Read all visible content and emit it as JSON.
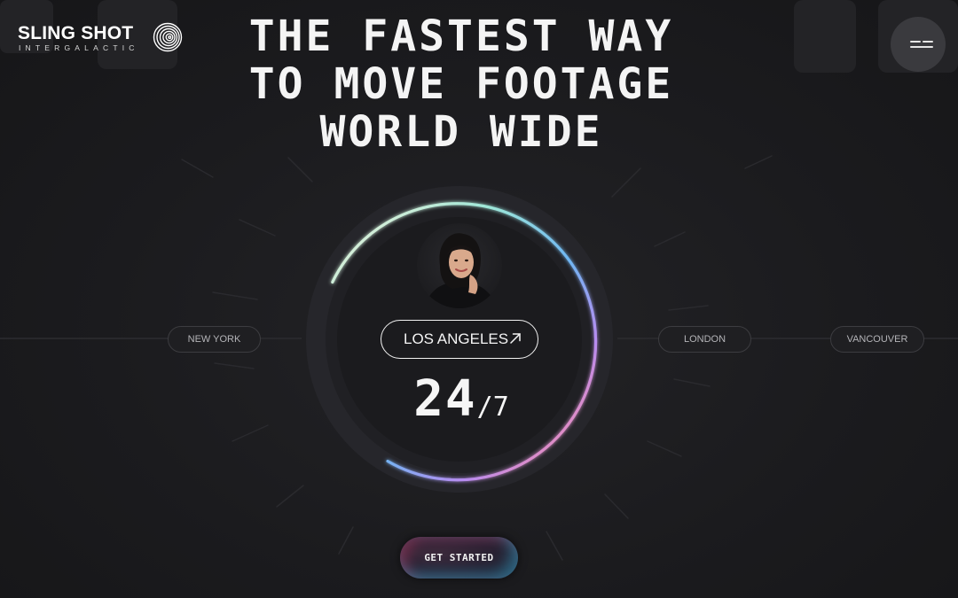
{
  "brand": {
    "name": "SLING SHOT",
    "tagline": "INTERGALACTIC",
    "mark_icon": "spiral-fingerprint-icon"
  },
  "hero": {
    "headline_lines": [
      "THE FASTEST WAY",
      "TO MOVE FOOTAGE",
      "WORLD WIDE"
    ]
  },
  "menu": {
    "icon": "hamburger-icon"
  },
  "locations": {
    "cities": [
      "NEW YORK",
      "LONDON",
      "VANCOUVER"
    ],
    "active_city": "LOS ANGELES",
    "active_icon": "arrow-up-right-icon"
  },
  "availability": {
    "hours": "24",
    "days": "/7"
  },
  "cta": {
    "label": "GET STARTED"
  },
  "colors": {
    "background": "#1b1b1e",
    "text": "#ffffff",
    "pill_border": "#3c3c40",
    "ring_gradient": [
      "#f7f3d9",
      "#9ee7d8",
      "#6fb6f2",
      "#b78cf0",
      "#f08db4",
      "#f07a50"
    ]
  }
}
